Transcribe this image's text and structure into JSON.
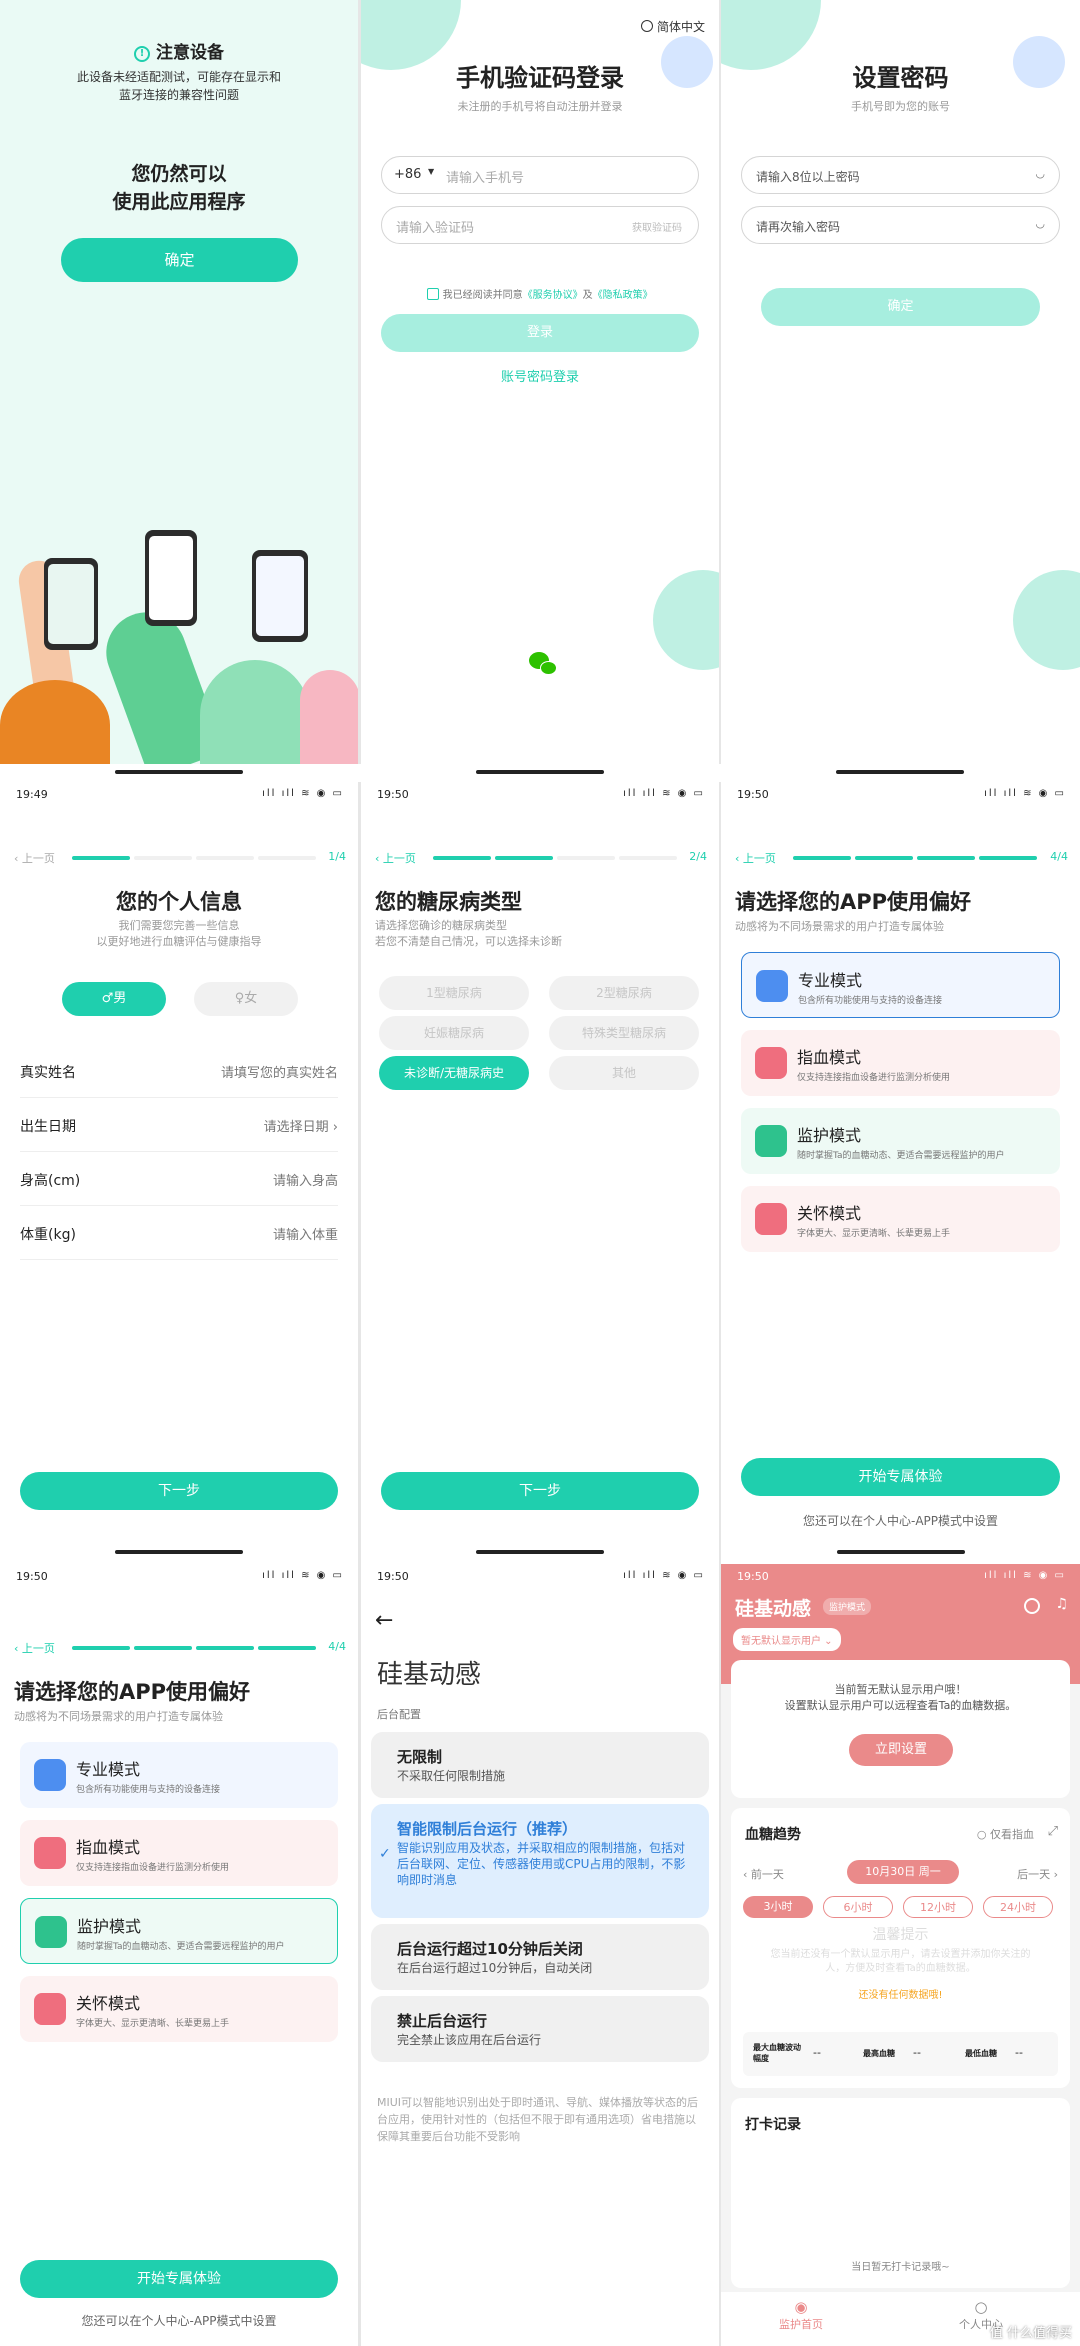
{
  "status": {
    "time_1949": "19:49",
    "time_1950": "19:50",
    "icons": "ıll ıll ≋ ◉ ▭"
  },
  "warning": {
    "icon": "info-circle-icon",
    "title": "注意设备",
    "desc_line1": "此设备未经适配测试，可能存在显示和",
    "desc_line2": "蓝牙连接的兼容性问题",
    "headline_line1": "您仍然可以",
    "headline_line2": "使用此应用程序",
    "confirm": "确定"
  },
  "sms_login": {
    "language": "简体中文",
    "title": "手机验证码登录",
    "subtitle": "未注册的手机号将自动注册并登录",
    "country_code": "+86",
    "phone_placeholder": "请输入手机号",
    "code_placeholder": "请输入验证码",
    "get_code": "获取验证码",
    "agree_prefix": "我已经阅读并同意",
    "service_agreement": "《服务协议》",
    "and": "及",
    "privacy_policy": "《隐私政策》",
    "login": "登录",
    "password_login": "账号密码登录",
    "wechat_icon": "wechat-icon"
  },
  "set_password": {
    "title": "设置密码",
    "subtitle": "手机号即为您的账号",
    "pwd_placeholder": "请输入8位以上密码",
    "pwd_confirm_placeholder": "请再次输入密码",
    "confirm": "确定"
  },
  "personal_info": {
    "back": "上一页",
    "step": "1/4",
    "title": "您的个人信息",
    "subtitle_line1": "我们需要您完善一些信息",
    "subtitle_line2": "以更好地进行血糖评估与健康指导",
    "male": "♂男",
    "female": "♀女",
    "rows": [
      {
        "label": "真实姓名",
        "value": "请填写您的真实姓名"
      },
      {
        "label": "出生日期",
        "value": "请选择日期 ›"
      },
      {
        "label": "身高(cm)",
        "value": "请输入身高"
      },
      {
        "label": "体重(kg)",
        "value": "请输入体重"
      }
    ],
    "next": "下一步"
  },
  "diabetes_type": {
    "back": "上一页",
    "step": "2/4",
    "title": "您的糖尿病类型",
    "subtitle_line1": "请选择您确诊的糖尿病类型",
    "subtitle_line2": "若您不清楚自己情况，可以选择未诊断",
    "options": [
      "1型糖尿病",
      "2型糖尿病",
      "妊娠糖尿病",
      "特殊类型糖尿病",
      "未诊断/无糖尿病史",
      "其他"
    ],
    "next": "下一步"
  },
  "preference": {
    "back": "上一页",
    "step": "4/4",
    "title": "请选择您的APP使用偏好",
    "subtitle": "动感将为不同场景需求的用户打造专属体验",
    "modes": [
      {
        "name": "专业模式",
        "desc": "包含所有功能使用与支持的设备连接"
      },
      {
        "name": "指血模式",
        "desc": "仅支持连接指血设备进行监测分析使用"
      },
      {
        "name": "监护模式",
        "desc": "随时掌握Ta的血糖动态、更适合需要远程监护的用户"
      },
      {
        "name": "关怀模式",
        "desc": "字体更大、显示更清晰、长辈更易上手"
      }
    ],
    "start": "开始专属体验",
    "hint": "您还可以在个人中心-APP模式中设置"
  },
  "background": {
    "app_name": "硅基动感",
    "section": "后台配置",
    "options": [
      {
        "name": "无限制",
        "desc": "不采取任何限制措施"
      },
      {
        "name": "智能限制后台运行（推荐）",
        "desc": "智能识别应用及状态，并采取相应的限制措施，包括对后台联网、定位、传感器使用或CPU占用的限制，不影响即时消息"
      },
      {
        "name": "后台运行超过10分钟后关闭",
        "desc": "在后台运行超过10分钟后，自动关闭"
      },
      {
        "name": "禁止后台运行",
        "desc": "完全禁止该应用在后台运行"
      }
    ],
    "footer": "MIUI可以智能地识别出处于即时通讯、导航、媒体播放等状态的后台应用，使用针对性的（包括但不限于即有通用选项）省电措施以保障其重要后台功能不受影响"
  },
  "home": {
    "brand": "硅基动感",
    "mode_badge": "监护模式",
    "user_selector": "暂无默认显示用户 ⌄",
    "notice_line1": "当前暂无默认显示用户哦！",
    "notice_line2": "设置默认显示用户可以远程查看Ta的血糖数据。",
    "setup": "立即设置",
    "trend_title": "血糖趋势",
    "only_finger": "仅看指血",
    "prev_day": "‹ 前一天",
    "date": "10月30日 周一",
    "next_day": "后一天 ›",
    "ranges": [
      "3小时",
      "6小时",
      "12小时",
      "24小时"
    ],
    "overlay_title": "温馨提示",
    "overlay_text": "您当前还没有一个默认显示用户，请去设置并添加你关注的人，方便及时查看Ta的血糖数据。",
    "no_data": "还没有任何数据哦!",
    "stats": [
      {
        "label": "最大血糖波动幅度",
        "value": "--"
      },
      {
        "label": "最高血糖",
        "value": "--"
      },
      {
        "label": "最低血糖",
        "value": "--"
      }
    ],
    "checkin_title": "打卡记录",
    "checkin_empty": "当日暂无打卡记录哦~",
    "nav_home": "监护首页",
    "nav_me": "个人中心",
    "watermark": "值 什么值得买"
  },
  "colors": {
    "teal": "#1fcfae",
    "pale_teal": "#a7eedf",
    "coral": "#ea8a8a",
    "blue_selected": "#2f7fd8"
  }
}
